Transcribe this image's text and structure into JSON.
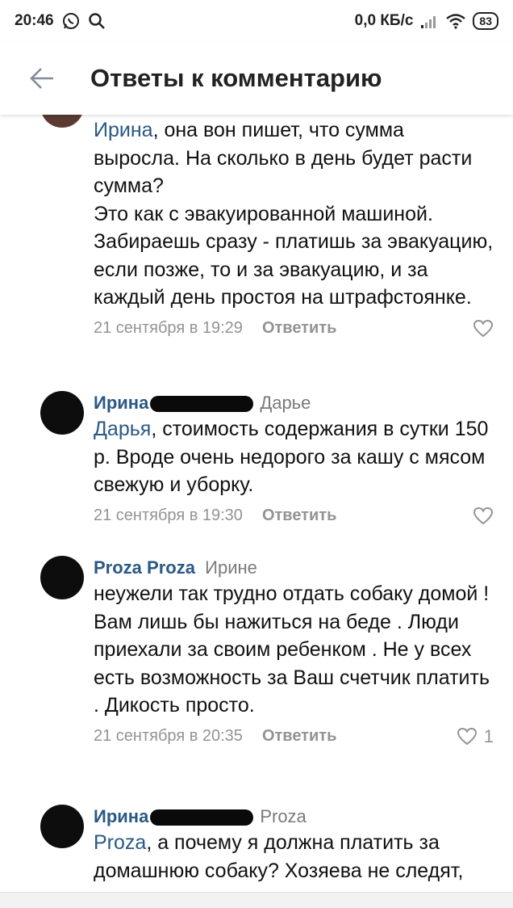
{
  "status_bar": {
    "time": "20:46",
    "net_speed": "0,0 КБ/с",
    "battery": "83"
  },
  "header": {
    "title": "Ответы к комментарию"
  },
  "comments": [
    {
      "text_mention": "Ирина",
      "text": ", она вон пишет, что сумма выросла. На сколько в день будет расти сумма?\nЭто как с эвакуированной машиной. Забираешь сразу - платишь за эвакуацию, если позже, то и за эвакуацию, и за каждый день простоя на штрафстоянке.",
      "date": "21 сентября в 19:29",
      "reply_label": "Ответить"
    },
    {
      "author": "Ирина",
      "reply_to": "Дарье",
      "text_mention": "Дарья",
      "text": ", стоимость содержания в сутки 150 р. Вроде очень недорого за кашу с мясом свежую и уборку.",
      "date": "21 сентября в 19:30",
      "reply_label": "Ответить"
    },
    {
      "author": "Proza Proza",
      "reply_to": "Ирине",
      "text": "неужели так трудно отдать собаку домой ! Вам лишь бы нажиться на беде . Люди приехали за своим ребенком . Не у всех есть возможность за Ваш счетчик платить . Дикость просто.",
      "date": "21 сентября в 20:35",
      "reply_label": "Ответить",
      "likes": "1"
    },
    {
      "author": "Ирина",
      "reply_to": "Proza",
      "text_mention": "Proza",
      "text": ", а почему я должна платить за домашнюю собаку? Хозяева не следят,"
    }
  ]
}
